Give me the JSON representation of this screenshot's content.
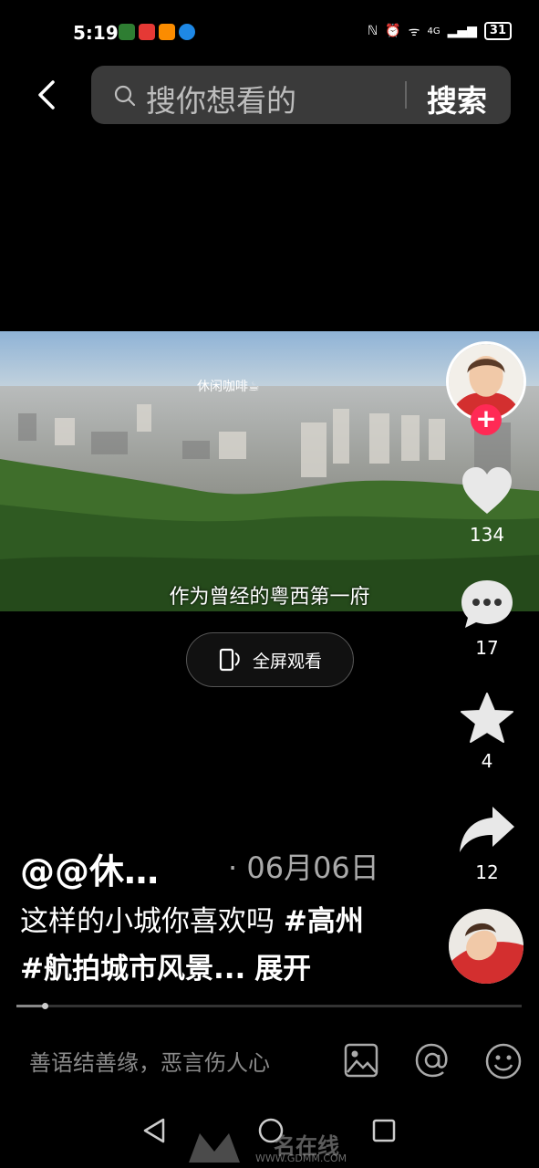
{
  "status": {
    "time": "5:19",
    "signal": "4G",
    "battery": "31"
  },
  "search": {
    "placeholder": "搜你想看的",
    "button": "搜索"
  },
  "video": {
    "watermark": "休闲咖啡☕",
    "subtitle": "作为曾经的粤西第一府",
    "fullscreen_label": "全屏观看"
  },
  "rail": {
    "likes": "134",
    "comments": "17",
    "favorites": "4",
    "shares": "12"
  },
  "post": {
    "author": "@@休…",
    "date": "· 06月06日",
    "text_plain": "这样的小城你喜欢吗 ",
    "tag1": "#高州",
    "tag2": "#航拍城市风景",
    "ellipsis": "...",
    "expand": "展开",
    "progress": 0.06
  },
  "comment": {
    "placeholder": "善语结善缘，恶言伤人心"
  },
  "overlay_watermark": {
    "brand": "名在线",
    "url": "WWW.GDMM.COM"
  },
  "colors": {
    "accent": "#ff2a55",
    "background": "#000000"
  }
}
